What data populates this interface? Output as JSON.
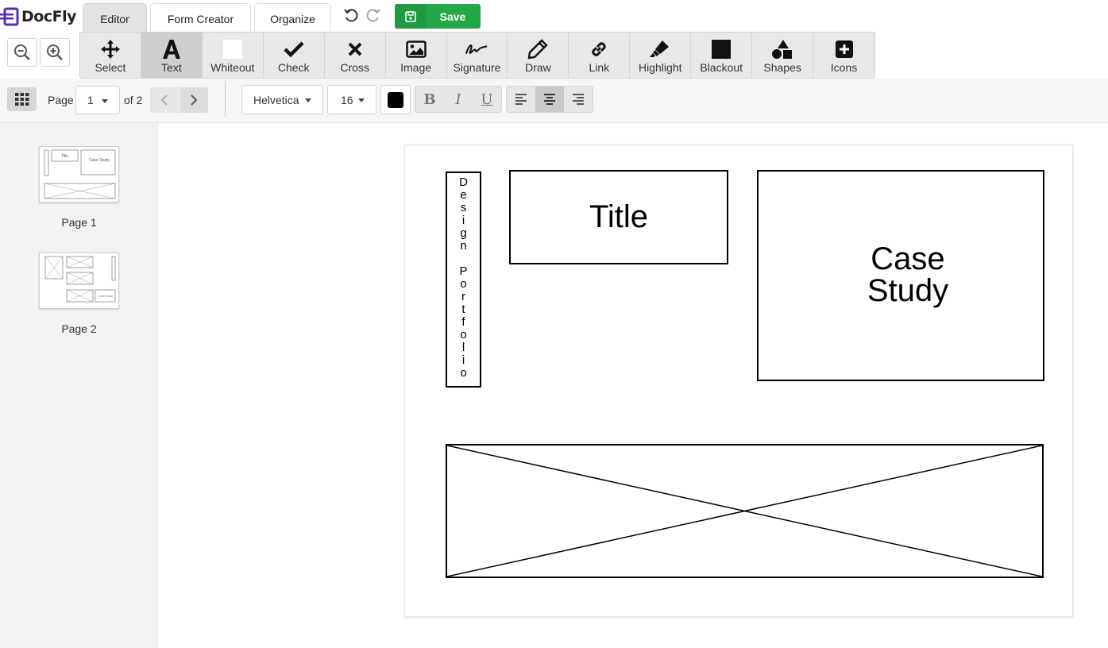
{
  "app": {
    "name": "DocFly",
    "brand_color": "#5b2bb5",
    "save_color": "#22a846"
  },
  "tabs": [
    {
      "label": "Editor",
      "active": true
    },
    {
      "label": "Form Creator",
      "active": false
    },
    {
      "label": "Organize",
      "active": false
    }
  ],
  "history": {
    "undo_icon": "undo-icon",
    "redo_icon": "redo-icon"
  },
  "save": {
    "label": "Save",
    "icon": "save-icon"
  },
  "zoom": {
    "out_icon": "zoom-out-icon",
    "in_icon": "zoom-in-icon"
  },
  "tools": [
    {
      "label": "Select",
      "icon": "move-icon",
      "active": false
    },
    {
      "label": "Text",
      "icon": "text-icon",
      "active": true
    },
    {
      "label": "Whiteout",
      "icon": "whiteout-icon",
      "active": false
    },
    {
      "label": "Check",
      "icon": "check-icon",
      "active": false
    },
    {
      "label": "Cross",
      "icon": "cross-icon",
      "active": false
    },
    {
      "label": "Image",
      "icon": "image-icon",
      "active": false
    },
    {
      "label": "Signature",
      "icon": "signature-icon",
      "active": false
    },
    {
      "label": "Draw",
      "icon": "pencil-icon",
      "active": false
    },
    {
      "label": "Link",
      "icon": "link-icon",
      "active": false
    },
    {
      "label": "Highlight",
      "icon": "highlighter-icon",
      "active": false
    },
    {
      "label": "Blackout",
      "icon": "blackout-icon",
      "active": false
    },
    {
      "label": "Shapes",
      "icon": "shapes-icon",
      "active": false
    },
    {
      "label": "Icons",
      "icon": "plus-square-icon",
      "active": false
    }
  ],
  "formatbar": {
    "page_label": "Page",
    "page_value": "1",
    "of_label": "of 2",
    "font": "Helvetica",
    "size": "16",
    "color": "#000000",
    "bold": "B",
    "italic": "I",
    "underline": "U",
    "align_active": "center"
  },
  "sidebar": {
    "pages": [
      {
        "label": "Page 1",
        "thumb_title": "Title",
        "thumb_case": "Case Study"
      },
      {
        "label": "Page 2",
        "thumb_case": "Case Study"
      }
    ]
  },
  "document": {
    "vertical_text": "Design Portfolio",
    "title": "Title",
    "case_line1": "Case",
    "case_line2": "Study"
  }
}
